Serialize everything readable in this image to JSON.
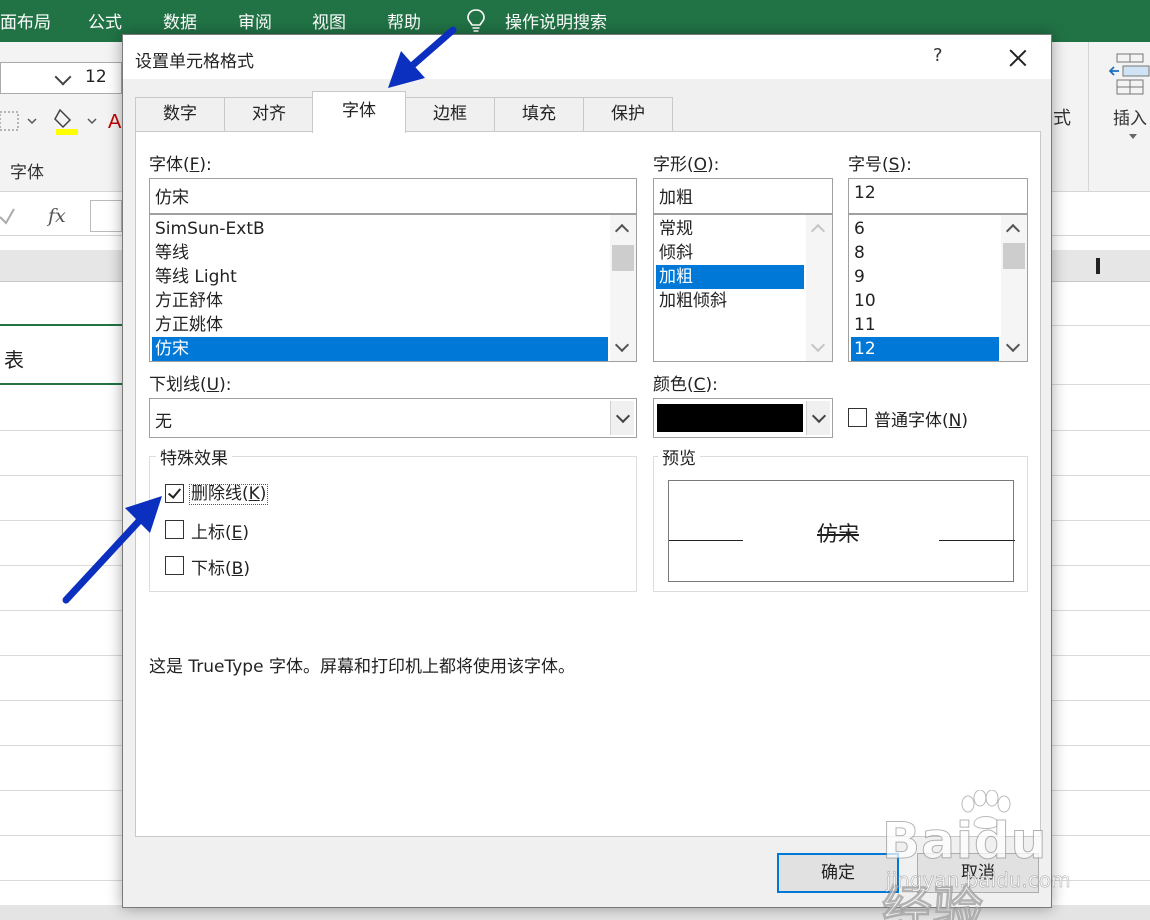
{
  "excel": {
    "ribbon_tabs": [
      "面布局",
      "公式",
      "数据",
      "审阅",
      "视图",
      "帮助"
    ],
    "tell_me": "操作说明搜索",
    "font_size": "12",
    "font_group_label": "字体",
    "partial_right_label": "式",
    "insert_label": "插入",
    "cell_text": "表",
    "colors": {
      "ribbon_green": "#217346"
    }
  },
  "dialog": {
    "title": "设置单元格格式",
    "help": "?",
    "tabs": [
      {
        "label": "数字",
        "active": false
      },
      {
        "label": "对齐",
        "active": false
      },
      {
        "label": "字体",
        "active": true
      },
      {
        "label": "边框",
        "active": false
      },
      {
        "label": "填充",
        "active": false
      },
      {
        "label": "保护",
        "active": false
      }
    ],
    "font": {
      "label": "字体(",
      "key": "F",
      "label_end": "):",
      "value": "仿宋",
      "items": [
        "SimSun-ExtB",
        "等线",
        "等线 Light",
        "方正舒体",
        "方正姚体",
        "仿宋"
      ],
      "selected_index": 5
    },
    "style": {
      "label": "字形(",
      "key": "O",
      "label_end": "):",
      "value": "加粗",
      "items": [
        "常规",
        "倾斜",
        "加粗",
        "加粗倾斜"
      ],
      "selected_index": 2
    },
    "size": {
      "label": "字号(",
      "key": "S",
      "label_end": "):",
      "value": "12",
      "items": [
        "6",
        "8",
        "9",
        "10",
        "11",
        "12"
      ],
      "selected_index": 5
    },
    "underline": {
      "label": "下划线(",
      "key": "U",
      "label_end": "):",
      "value": "无"
    },
    "color": {
      "label": "颜色(",
      "key": "C",
      "label_end": "):",
      "value_hex": "#000000"
    },
    "normal_font": {
      "label": "普通字体(",
      "key": "N",
      "label_end": ")",
      "checked": false
    },
    "effects": {
      "title": "特殊效果",
      "strikethrough": {
        "label": "删除线(",
        "key": "K",
        "label_end": ")",
        "checked": true
      },
      "superscript": {
        "label": "上标(",
        "key": "E",
        "label_end": ")",
        "checked": false
      },
      "subscript": {
        "label": "下标(",
        "key": "B",
        "label_end": ")",
        "checked": false
      }
    },
    "preview": {
      "title": "预览",
      "text": "仿宋"
    },
    "info": "这是 TrueType 字体。屏幕和打印机上都将使用该字体。",
    "ok_button": "确定",
    "cancel_button": "取消",
    "colors": {
      "selection": "#0078d7",
      "dialog_bg": "#f0f0f0",
      "annotation_arrow": "#0b2fbf"
    }
  },
  "watermark": {
    "brand": "Baidu经验",
    "url": "jingyan.baidu.com"
  }
}
